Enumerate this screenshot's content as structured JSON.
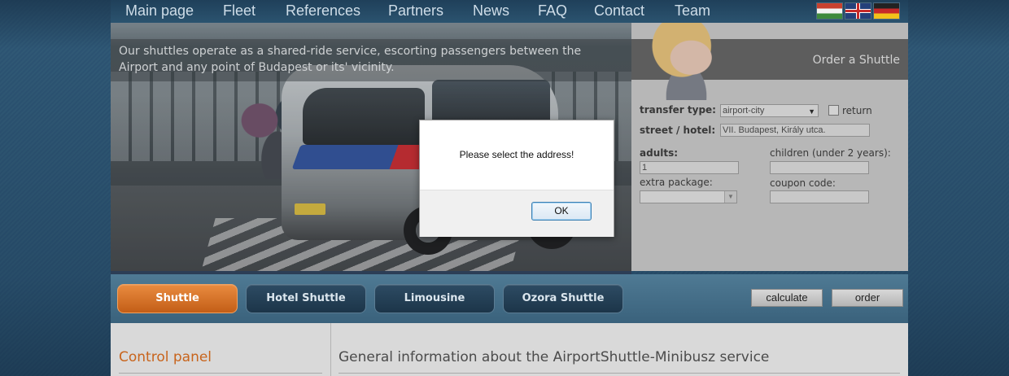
{
  "nav": {
    "items": [
      "Main page",
      "Fleet",
      "References",
      "Partners",
      "News",
      "FAQ",
      "Contact",
      "Team"
    ],
    "languages": [
      "Hungarian",
      "English",
      "German"
    ]
  },
  "hero": {
    "caption": "Our shuttles operate as a shared-ride service, escorting passengers between the Airport and any point of Budapest or its' vicinity."
  },
  "order_form": {
    "title": "Order a Shuttle",
    "transfer_type_label": "transfer type:",
    "transfer_type_value": "airport-city",
    "return_label": "return",
    "street_label": "street / hotel:",
    "street_value": "VII. Budapest, Király utca.",
    "adults_label": "adults:",
    "adults_value": "1",
    "children_label": "children (under 2 years):",
    "children_value": "",
    "extra_package_label": "extra package:",
    "extra_package_value": "",
    "coupon_label": "coupon code:",
    "coupon_value": ""
  },
  "service_tabs": [
    "Shuttle",
    "Hotel Shuttle",
    "Limousine",
    "Ozora Shuttle"
  ],
  "actions": {
    "calculate": "calculate",
    "order": "order"
  },
  "content": {
    "control_panel": "Control panel",
    "general_info": "General information about the AirportShuttle-Minibusz service"
  },
  "dialog": {
    "message": "Please select the address!",
    "ok_label": "OK"
  },
  "colors": {
    "active_tab": "#d86f23",
    "control_panel_title": "#c8641c",
    "page_bg": "#2f5874"
  }
}
